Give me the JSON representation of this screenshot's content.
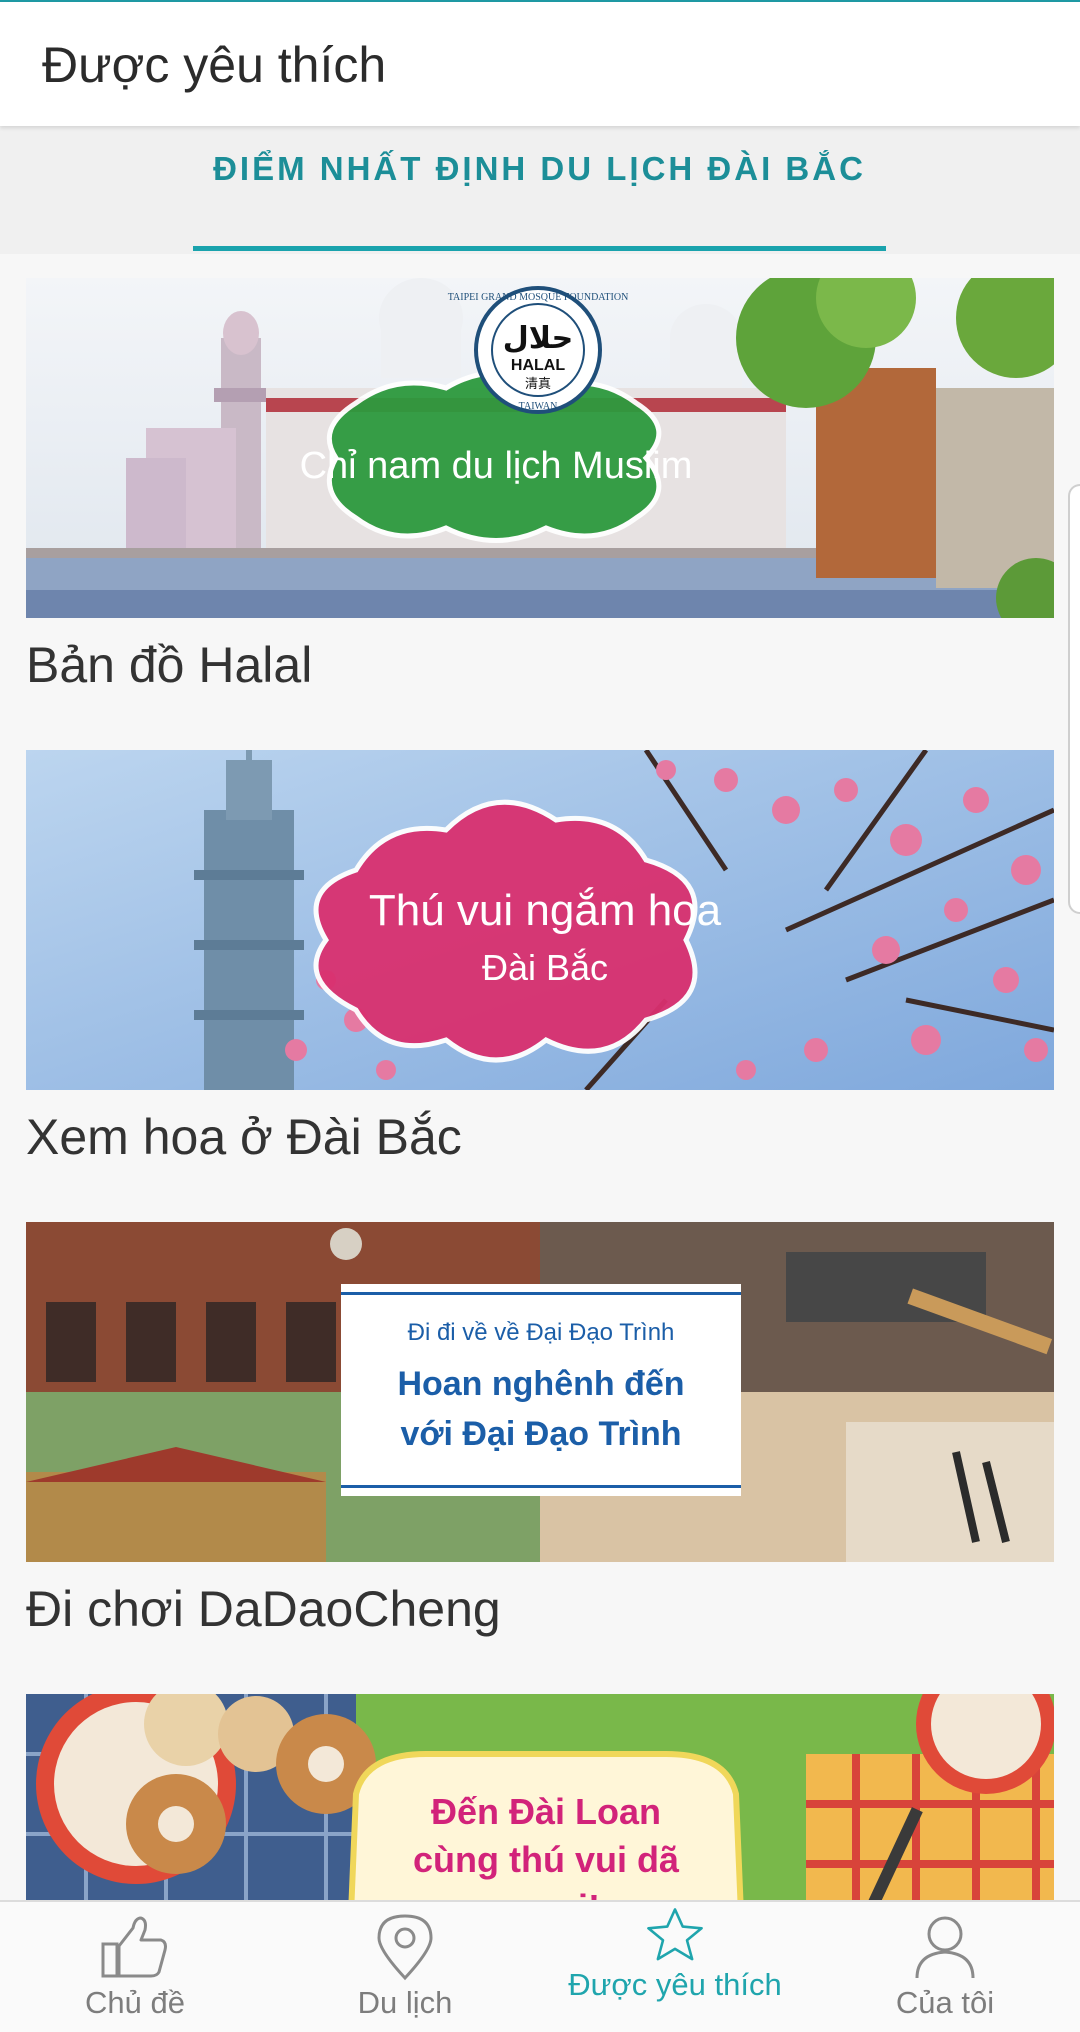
{
  "header": {
    "title": "Được yêu thích"
  },
  "tabs": [
    {
      "label": "ĐIỂM NHẤT ĐỊNH DU LỊCH ĐÀI BẮC",
      "active": true
    }
  ],
  "cards": [
    {
      "title": "Bản đồ Halal",
      "banner_text": "Chỉ nam du lịch Muslim",
      "seal_top_text": "TAIPEI GRAND MOSQUE FOUNDATION",
      "seal_arabic": "حلال",
      "seal_word": "HALAL",
      "seal_chinese": "清真",
      "seal_bottom_text": "TAIWAN"
    },
    {
      "title": "Xem hoa ở Đài Bắc",
      "banner_line1": "Thú vui ngắm hoa",
      "banner_line2": "Đài Bắc"
    },
    {
      "title": "Đi chơi DaDaoCheng",
      "banner_small": "Đi đi về về Đại Đạo Trình",
      "banner_line1": "Hoan nghênh đến",
      "banner_line2": "với Đại Đạo Trình"
    },
    {
      "title": "",
      "banner_line1": "Đến Đài Loan",
      "banner_line2": "cùng thú vui dã",
      "banner_line3": "ngoại!"
    }
  ],
  "bottom_nav": [
    {
      "label": "Chủ đề",
      "icon": "thumbs-up-icon",
      "active": false
    },
    {
      "label": "Du lịch",
      "icon": "location-pin-icon",
      "active": false
    },
    {
      "label": "Được yêu thích",
      "icon": "star-icon",
      "active": true
    },
    {
      "label": "Của tôi",
      "icon": "user-icon",
      "active": false
    }
  ],
  "colors": {
    "accent": "#1fa5ad",
    "tab_text": "#1c8e98",
    "nav_inactive": "#7d7d7d",
    "halal_green": "#2d9a3e",
    "flower_pink": "#d9306f",
    "dadao_blue": "#1b5ea8",
    "picnic_pink": "#d2237a"
  }
}
